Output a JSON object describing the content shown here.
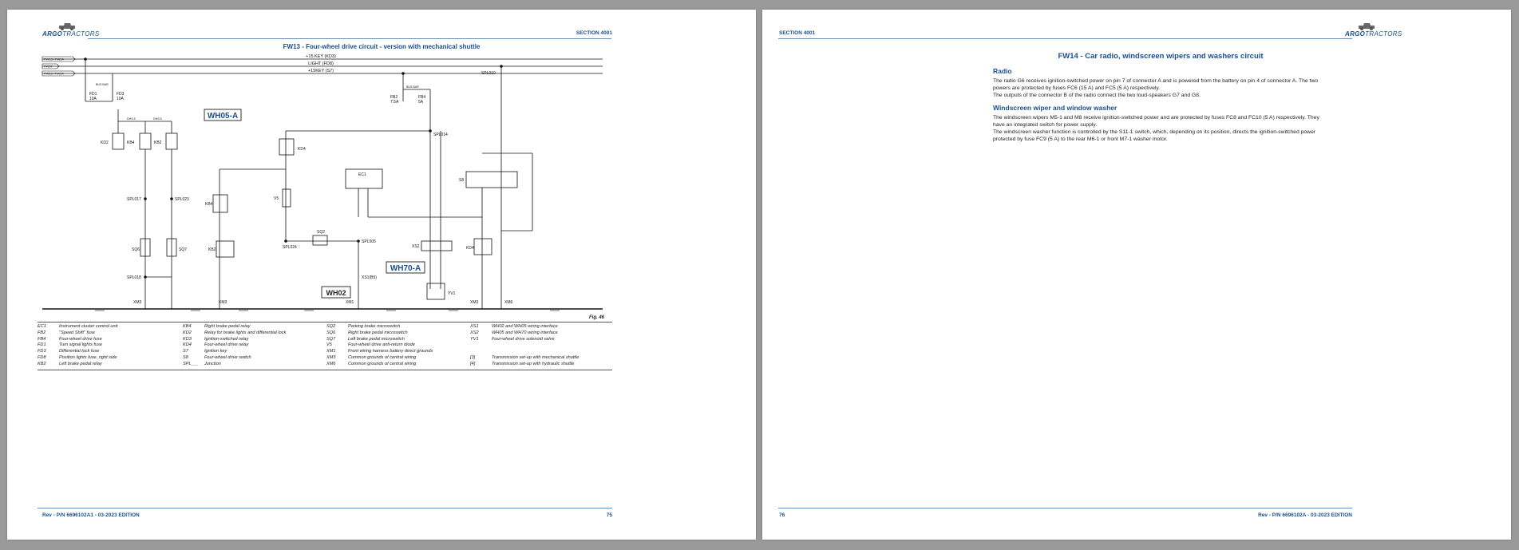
{
  "left_page": {
    "logo_brand": "ARGO",
    "logo_suffix": "TRACTORS",
    "section": "SECTION 4001",
    "figure_title": "FW13 - Four-wheel drive circuit - version with mechanical shuttle",
    "figure_label": "Fig. 46",
    "footer_left": "Rev - P/N 6696102A1 - 03-2023 EDITION",
    "page_number": "75",
    "diagram": {
      "supply_lines": [
        "+15 KEY (KD3)",
        "LIGHT (FD8)",
        "+15KEY (S7)"
      ],
      "left_tags": [
        "FW13 / FW14",
        "FW37",
        "FW13 / FW14"
      ],
      "harness_labels": [
        "WH05-A",
        "WH70-A",
        "WH02"
      ],
      "fuse_labels": [
        "FD1",
        "10A",
        "FD3",
        "10A",
        "FB2",
        "7.5A",
        "FB4",
        "5A"
      ],
      "components": [
        "KD2",
        "KB4",
        "KB2",
        "KD4",
        "EC1",
        "V5",
        "SQ2",
        "S8",
        "XS2",
        "YV1",
        "KD4",
        "KB4",
        "KB2",
        "SQ6",
        "SQ7"
      ],
      "junctions": [
        "SPL010",
        "SPL014",
        "SPL017",
        "SPL023",
        "SPL018",
        "SPL024",
        "SPL005"
      ],
      "grounds": [
        "XM3",
        "XM3",
        "XM1",
        "XS1(B5)",
        "XM3",
        "XM6"
      ],
      "wire_codes": [
        "BUS BAR",
        "DHS.5",
        "DHS.5",
        "BUS BAR"
      ]
    },
    "legend": [
      [
        [
          "EC1",
          "Instrument cluster control unit"
        ],
        [
          "FB2",
          "\"Speed Shift\" fuse"
        ],
        [
          "FB4",
          "Four-wheel drive fuse"
        ],
        [
          "FD1",
          "Turn signal lights fuse"
        ],
        [
          "FD3",
          "Differential lock fuse"
        ],
        [
          "FD8",
          "Position lights fuse, right side"
        ],
        [
          "KB2",
          "Left brake pedal relay"
        ]
      ],
      [
        [
          "KB4",
          "Right brake pedal relay"
        ],
        [
          "KD2",
          "Relay for brake lights and differential lock"
        ],
        [
          "KD3",
          "Ignition-switched relay"
        ],
        [
          "KD4",
          "Four-wheel drive relay"
        ],
        [
          "S7",
          "Ignition key"
        ],
        [
          "S8",
          "Four-wheel drive switch"
        ],
        [
          "SPL___",
          "Junction"
        ]
      ],
      [
        [
          "SQ2",
          "Parking brake microswitch"
        ],
        [
          "SQ6",
          "Right brake pedal microswitch"
        ],
        [
          "SQ7",
          "Left brake pedal microswitch"
        ],
        [
          "V5",
          "Four-wheel drive anti-return diode"
        ],
        [
          "XM1",
          "Front wiring harness battery direct grounds"
        ],
        [
          "XM3",
          "Common grounds of central wiring"
        ],
        [
          "XM6",
          "Common grounds of central wiring"
        ]
      ],
      [
        [
          "XS1",
          "WH02 and WH05 wiring interface"
        ],
        [
          "XS2",
          "WH05 and WH70 wiring interface"
        ],
        [
          "YV1",
          "Four-wheel drive solenoid valve"
        ],
        [
          "",
          ""
        ],
        [
          "",
          ""
        ],
        [
          "[3]",
          "Transmission set-up with mechanical shuttle"
        ],
        [
          "[4]",
          "Transmission set-up with hydraulic shuttle"
        ]
      ]
    ]
  },
  "right_page": {
    "logo_brand": "ARGO",
    "logo_suffix": "TRACTORS",
    "section": "SECTION 4001",
    "title": "FW14 - Car radio, windscreen wipers and washers circuit",
    "radio_heading": "Radio",
    "radio_p1": "The radio G6 receives ignition-switched power on pin 7 of connector A and is powered from the battery on pin 4 of connector A. The two powers are protected by fuses FC6 (15 A) and FC5 (5 A) respectively.",
    "radio_p2": "The outputs of the connector B of the radio connect the two loud-speakers G7 and G8.",
    "wiper_heading": "Windscreen wiper and window washer",
    "wiper_p1": "The windscreen wipers M5-1 and M8 receive ignition-switched power and are protected by fuses FC8 and FC10 (5 A) respectively. They have an integrated switch for power supply.",
    "wiper_p2": "The windscreen washer function is controlled by the S11-1 switch, which, depending on its position, directs the ignition-switched power protected by fuse FC9 (5 A) to the rear M6-1 or front M7-1 washer motor.",
    "page_number": "76",
    "footer_right": "Rev - P/N 6696102A - 03-2023 EDITION"
  },
  "colors": {
    "accent": "#1a4f8a",
    "background": "#9a9a9a",
    "page": "#ffffff"
  },
  "icons": {
    "logo": "tractor-icon"
  }
}
